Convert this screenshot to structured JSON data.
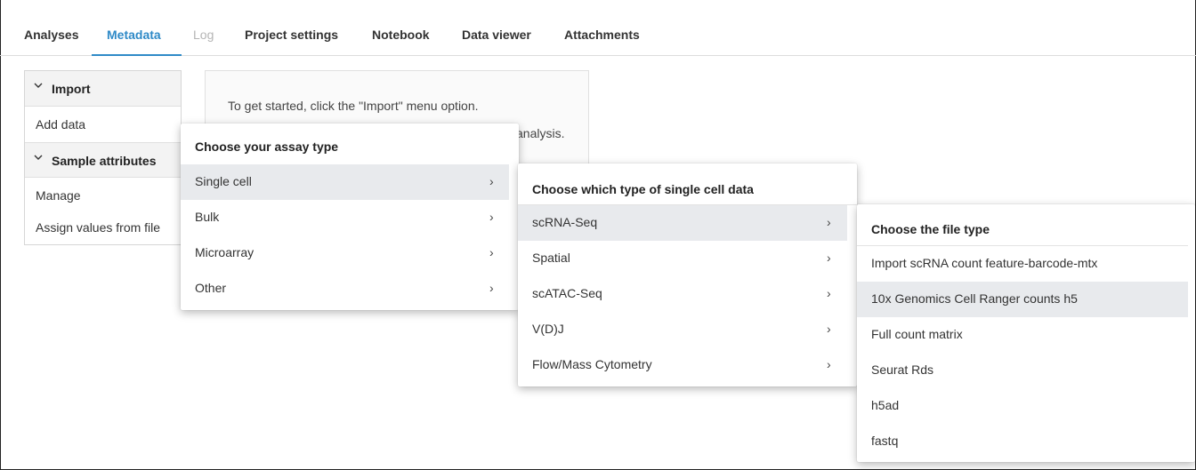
{
  "tabs": [
    {
      "label": "Analyses"
    },
    {
      "label": "Metadata"
    },
    {
      "label": "Log"
    },
    {
      "label": "Project settings"
    },
    {
      "label": "Notebook"
    },
    {
      "label": "Data viewer"
    },
    {
      "label": "Attachments"
    }
  ],
  "sidebar": {
    "import_header": "Import",
    "add_data": "Add data",
    "sample_attributes_header": "Sample attributes",
    "manage": "Manage",
    "assign_values": "Assign values from file"
  },
  "panel": {
    "line1": "To get started, click the \"Import\" menu option.",
    "line2_visible": "analysis."
  },
  "assay_menu": {
    "title": "Choose your assay type",
    "items": [
      "Single cell",
      "Bulk",
      "Microarray",
      "Other"
    ],
    "selected": "Single cell"
  },
  "single_cell_menu": {
    "title": "Choose which type of single cell data",
    "items": [
      "scRNA-Seq",
      "Spatial",
      "scATAC-Seq",
      "V(D)J",
      "Flow/Mass Cytometry"
    ],
    "selected": "scRNA-Seq"
  },
  "file_type_menu": {
    "title": "Choose the file type",
    "items": [
      "Import scRNA count feature-barcode-mtx",
      "10x Genomics Cell Ranger counts h5",
      "Full count matrix",
      "Seurat Rds",
      "h5ad",
      "fastq"
    ],
    "selected": "10x Genomics Cell Ranger counts h5"
  },
  "icons": {
    "submenu_arrow": "chevron-right-icon",
    "section_toggle": "chevron-down-icon"
  },
  "colors": {
    "accent": "#2f8ac7",
    "highlight": "#e8eaed",
    "disabled": "#b5b5b5"
  }
}
